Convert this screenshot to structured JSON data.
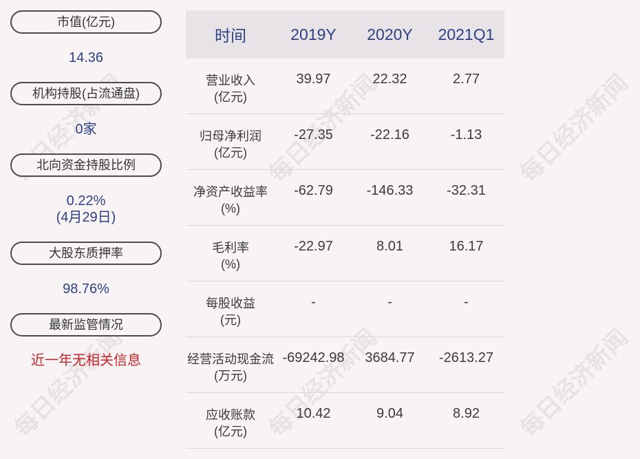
{
  "sidebar": {
    "items": [
      {
        "label": "市值(亿元)",
        "value": "14.36"
      },
      {
        "label": "机构持股(占流通盘)",
        "value": "0家"
      },
      {
        "label": "北向资金持股比例",
        "value": "0.22%",
        "value2": "(4月29日)"
      },
      {
        "label": "大股东质押率",
        "value": "98.76%"
      },
      {
        "label": "最新监管情况",
        "value": "近一年无相关信息"
      }
    ]
  },
  "table": {
    "headers": [
      "时间",
      "2019Y",
      "2020Y",
      "2021Q1"
    ],
    "rows": [
      {
        "label1": "营业收入",
        "label2": "(亿元)",
        "values": [
          "39.97",
          "22.32",
          "2.77"
        ]
      },
      {
        "label1": "归母净利润",
        "label2": "(亿元)",
        "values": [
          "-27.35",
          "-22.16",
          "-1.13"
        ]
      },
      {
        "label1": "净资产收益率",
        "label2": "(%)",
        "values": [
          "-62.79",
          "-146.33",
          "-32.31"
        ]
      },
      {
        "label1": "毛利率",
        "label2": "(%)",
        "values": [
          "-22.97",
          "8.01",
          "16.17"
        ]
      },
      {
        "label1": "每股收益",
        "label2": "(元)",
        "values": [
          "-",
          "-",
          "-"
        ]
      },
      {
        "label1": "经营活动现金流",
        "label2": "(万元)",
        "values": [
          "-69242.98",
          "3684.77",
          "-2613.27"
        ]
      },
      {
        "label1": "应收账款",
        "label2": "(亿元)",
        "values": [
          "10.42",
          "9.04",
          "8.92"
        ]
      }
    ]
  },
  "watermark": "每日经济新闻",
  "colors": {
    "value_blue": "#2d3f85",
    "alert_red": "#c8262a",
    "header_bg": "#e8e3e6",
    "background": "#f8f4f5"
  }
}
